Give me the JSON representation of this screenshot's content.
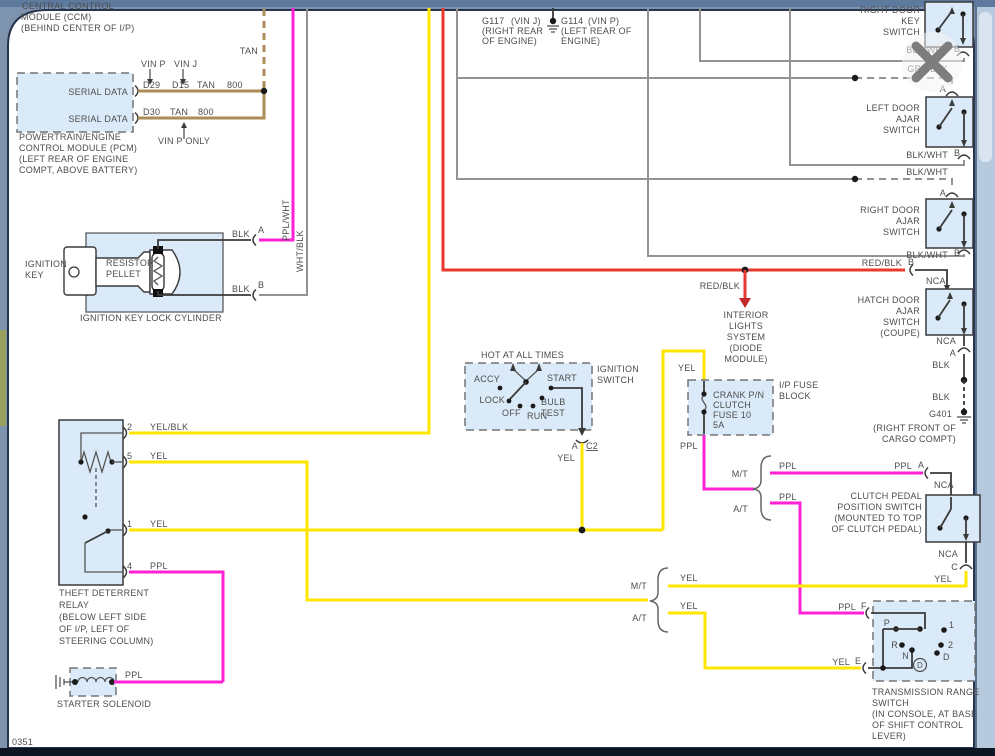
{
  "chrome": {
    "close_glyph": "close",
    "page_code": "0351"
  },
  "colors": {
    "yellow": "#ffe600",
    "magenta": "#ff22d5",
    "red": "#e8392f",
    "tan": "#ab8d55",
    "gray": "#939393",
    "black": "#3a3a3a",
    "box_fill": "#daeaf8",
    "text": "#4d4d4d"
  },
  "ccm": {
    "title": [
      "CENTRAL CONTROL",
      "MODULE (CCM)",
      "(BEHIND CENTER OF I/P)"
    ],
    "wire_tan": "TAN"
  },
  "pcm": {
    "pin1": "SERIAL DATA",
    "pin2": "SERIAL DATA",
    "vin_p": "VIN P",
    "vin_j": "VIN J",
    "term1": "D29",
    "term2": "D15",
    "color1": "TAN",
    "circuit1": "800",
    "term3": "D30",
    "color2": "TAN",
    "circuit2": "800",
    "note": "VIN P ONLY",
    "title": [
      "POWERTRAIN/ENGINE",
      "CONTROL MODULE (PCM)",
      "(LEFT REAR OF ENGINE",
      "COMPT, ABOVE BATTERY)"
    ]
  },
  "grounds": {
    "g117": "G117",
    "g117_vin": "(VIN J)",
    "g117_loc": [
      "(RIGHT REAR",
      "OF ENGINE)"
    ],
    "g114": "G114",
    "g114_vin": "(VIN P)",
    "g114_loc": [
      "(LEFT REAR OF",
      "ENGINE)"
    ]
  },
  "key_cylinder": {
    "key_label": [
      "IGNITION",
      "KEY"
    ],
    "pellet": [
      "RESISTOR",
      "PELLET"
    ],
    "title": "IGNITION KEY LOCK CYLINDER",
    "top_wire": "BLK",
    "top_term": "A",
    "top_color": "PPL/WHT",
    "bot_wire": "BLK",
    "bot_term": "B",
    "bot_color": "WHT/BLK"
  },
  "ignition_switch": {
    "hot": "HOT AT ALL TIMES",
    "title": [
      "IGNITION",
      "SWITCH"
    ],
    "accy": "ACCY",
    "lock": "LOCK",
    "off": "OFF",
    "run": "RUN",
    "bulb": [
      "BULB",
      "TEST"
    ],
    "start": "START",
    "term": "A",
    "conn": "C2",
    "wire": "YEL"
  },
  "relay": {
    "title": [
      "THEFT DETERRENT",
      "RELAY",
      "(BELOW LEFT SIDE",
      "OF I/P, LEFT OF",
      "STEERING COLUMN)"
    ],
    "t2": "2",
    "t2w": "YEL/BLK",
    "t5": "5",
    "t5w": "YEL",
    "t1": "1",
    "t1w": "YEL",
    "t4": "4",
    "t4w": "PPL"
  },
  "solenoid": {
    "title": "STARTER SOLENOID",
    "wire": "PPL"
  },
  "fuse": {
    "block": [
      "I/P FUSE",
      "BLOCK"
    ],
    "name": [
      "CRANK P/N",
      "CLUTCH",
      "FUSE 10",
      "5A"
    ],
    "in_wire": "YEL",
    "out_wire": "PPL"
  },
  "interior": {
    "wire": "RED/BLK",
    "title": [
      "INTERIOR",
      "LIGHTS",
      "SYSTEM",
      "(DIODE",
      "MODULE)"
    ]
  },
  "door_key_switch": {
    "title": [
      "RIGHT DOOR",
      "KEY",
      "SWITCH"
    ],
    "b_wire": "BLK/WHT",
    "b": "B",
    "a_wire": "GRY/BLK"
  },
  "left_ajar": {
    "title": [
      "LEFT DOOR",
      "AJAR",
      "SWITCH"
    ],
    "b_wire": "BLK/WHT",
    "b": "B",
    "a_wire": "BLK/WHT",
    "a": "A"
  },
  "right_ajar": {
    "title": [
      "RIGHT DOOR",
      "AJAR",
      "SWITCH"
    ],
    "b_wire": "BLK/WHT",
    "b": "B",
    "a": "A"
  },
  "hatch": {
    "in_wire": "RED/BLK",
    "in_term": "B",
    "in_nca": "NCA",
    "title": [
      "HATCH DOOR",
      "AJAR",
      "SWITCH",
      "(COUPE)"
    ],
    "out_nca": "NCA",
    "out_term": "A",
    "wire1": "BLK",
    "wire2": "BLK",
    "gnd": "G401",
    "gnd_loc": [
      "(RIGHT FRONT OF",
      "CARGO COMPT)"
    ]
  },
  "clutch": {
    "in_wire": "PPL",
    "in_term": "A",
    "in_nca": "NCA",
    "title": [
      "CLUTCH PEDAL",
      "POSITION SWITCH",
      "(MOUNTED TO TOP",
      "OF CLUTCH PEDAL)"
    ],
    "out_nca": "NCA",
    "out_term": "C",
    "out_wire": "YEL"
  },
  "ppl_split": {
    "mt": "M/T",
    "mt_wire": "PPL",
    "at": "A/T",
    "at_wire": "PPL"
  },
  "yel_split": {
    "mt": "M/T",
    "mt_wire": "YEL",
    "at": "A/T",
    "at_wire": "YEL"
  },
  "trs": {
    "in1": "PPL",
    "in1_term": "F",
    "in2": "YEL",
    "in2_term": "E",
    "p": "P",
    "r": "R",
    "n": "N",
    "d": "D",
    "dd": "D",
    "one": "1",
    "two": "2",
    "title": [
      "TRANSMISSION RANGE",
      "SWITCH",
      "(IN CONSOLE, AT BASE",
      "OF SHIFT CONTROL",
      "LEVER)"
    ]
  }
}
